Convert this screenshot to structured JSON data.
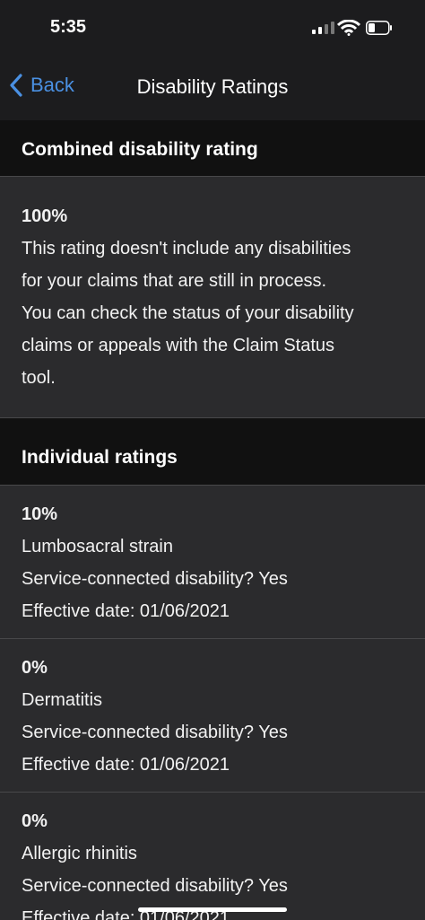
{
  "status": {
    "time": "5:35"
  },
  "nav": {
    "back_label": "Back",
    "title": "Disability Ratings"
  },
  "combined": {
    "header": "Combined disability rating",
    "percent": "100%",
    "lines": [
      "This rating doesn't include any disabilities",
      "for your claims that are still in process.",
      "You can check the status of your disability",
      "claims or appeals with the Claim Status",
      "tool."
    ]
  },
  "individual": {
    "header": "Individual ratings",
    "items": [
      {
        "percent": "10%",
        "condition": "Lumbosacral strain",
        "service_connected": "Service-connected disability?  Yes",
        "effective": "Effective date:  01/06/2021"
      },
      {
        "percent": "0%",
        "condition": "Dermatitis",
        "service_connected": "Service-connected disability?  Yes",
        "effective": "Effective date:  01/06/2021"
      },
      {
        "percent": "0%",
        "condition": "Allergic rhinitis",
        "service_connected": "Service-connected disability?  Yes",
        "effective": "Effective date:  01/06/2021"
      }
    ]
  }
}
